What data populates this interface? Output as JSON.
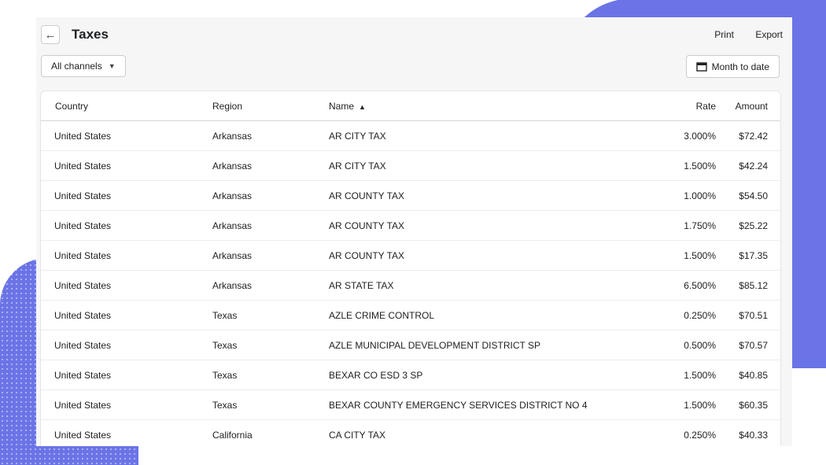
{
  "header": {
    "title": "Taxes",
    "print_label": "Print",
    "export_label": "Export"
  },
  "filters": {
    "channels_label": "All channels",
    "date_label": "Month to date"
  },
  "table": {
    "columns": [
      "Country",
      "Region",
      "Name",
      "Rate",
      "Amount"
    ],
    "sort_column": "Name",
    "sort_direction": "ascending",
    "rows": [
      {
        "country": "United States",
        "region": "Arkansas",
        "name": "AR CITY TAX",
        "rate": "3.000%",
        "amount": "$72.42"
      },
      {
        "country": "United States",
        "region": "Arkansas",
        "name": "AR CITY TAX",
        "rate": "1.500%",
        "amount": "$42.24"
      },
      {
        "country": "United States",
        "region": "Arkansas",
        "name": "AR COUNTY TAX",
        "rate": "1.000%",
        "amount": "$54.50"
      },
      {
        "country": "United States",
        "region": "Arkansas",
        "name": "AR COUNTY TAX",
        "rate": "1.750%",
        "amount": "$25.22"
      },
      {
        "country": "United States",
        "region": "Arkansas",
        "name": "AR COUNTY TAX",
        "rate": "1.500%",
        "amount": "$17.35"
      },
      {
        "country": "United States",
        "region": "Arkansas",
        "name": "AR STATE TAX",
        "rate": "6.500%",
        "amount": "$85.12"
      },
      {
        "country": "United States",
        "region": "Texas",
        "name": "AZLE CRIME CONTROL",
        "rate": "0.250%",
        "amount": "$70.51"
      },
      {
        "country": "United States",
        "region": "Texas",
        "name": "AZLE MUNICIPAL DEVELOPMENT DISTRICT SP",
        "rate": "0.500%",
        "amount": "$70.57"
      },
      {
        "country": "United States",
        "region": "Texas",
        "name": "BEXAR CO ESD 3 SP",
        "rate": "1.500%",
        "amount": "$40.85"
      },
      {
        "country": "United States",
        "region": "Texas",
        "name": "BEXAR COUNTY EMERGENCY SERVICES DISTRICT NO 4",
        "rate": "1.500%",
        "amount": "$60.35"
      },
      {
        "country": "United States",
        "region": "California",
        "name": "CA CITY TAX",
        "rate": "0.250%",
        "amount": "$40.33"
      }
    ]
  },
  "colors": {
    "accent_decoration": "#6b74e6",
    "panel_background": "#f6f6f7"
  }
}
